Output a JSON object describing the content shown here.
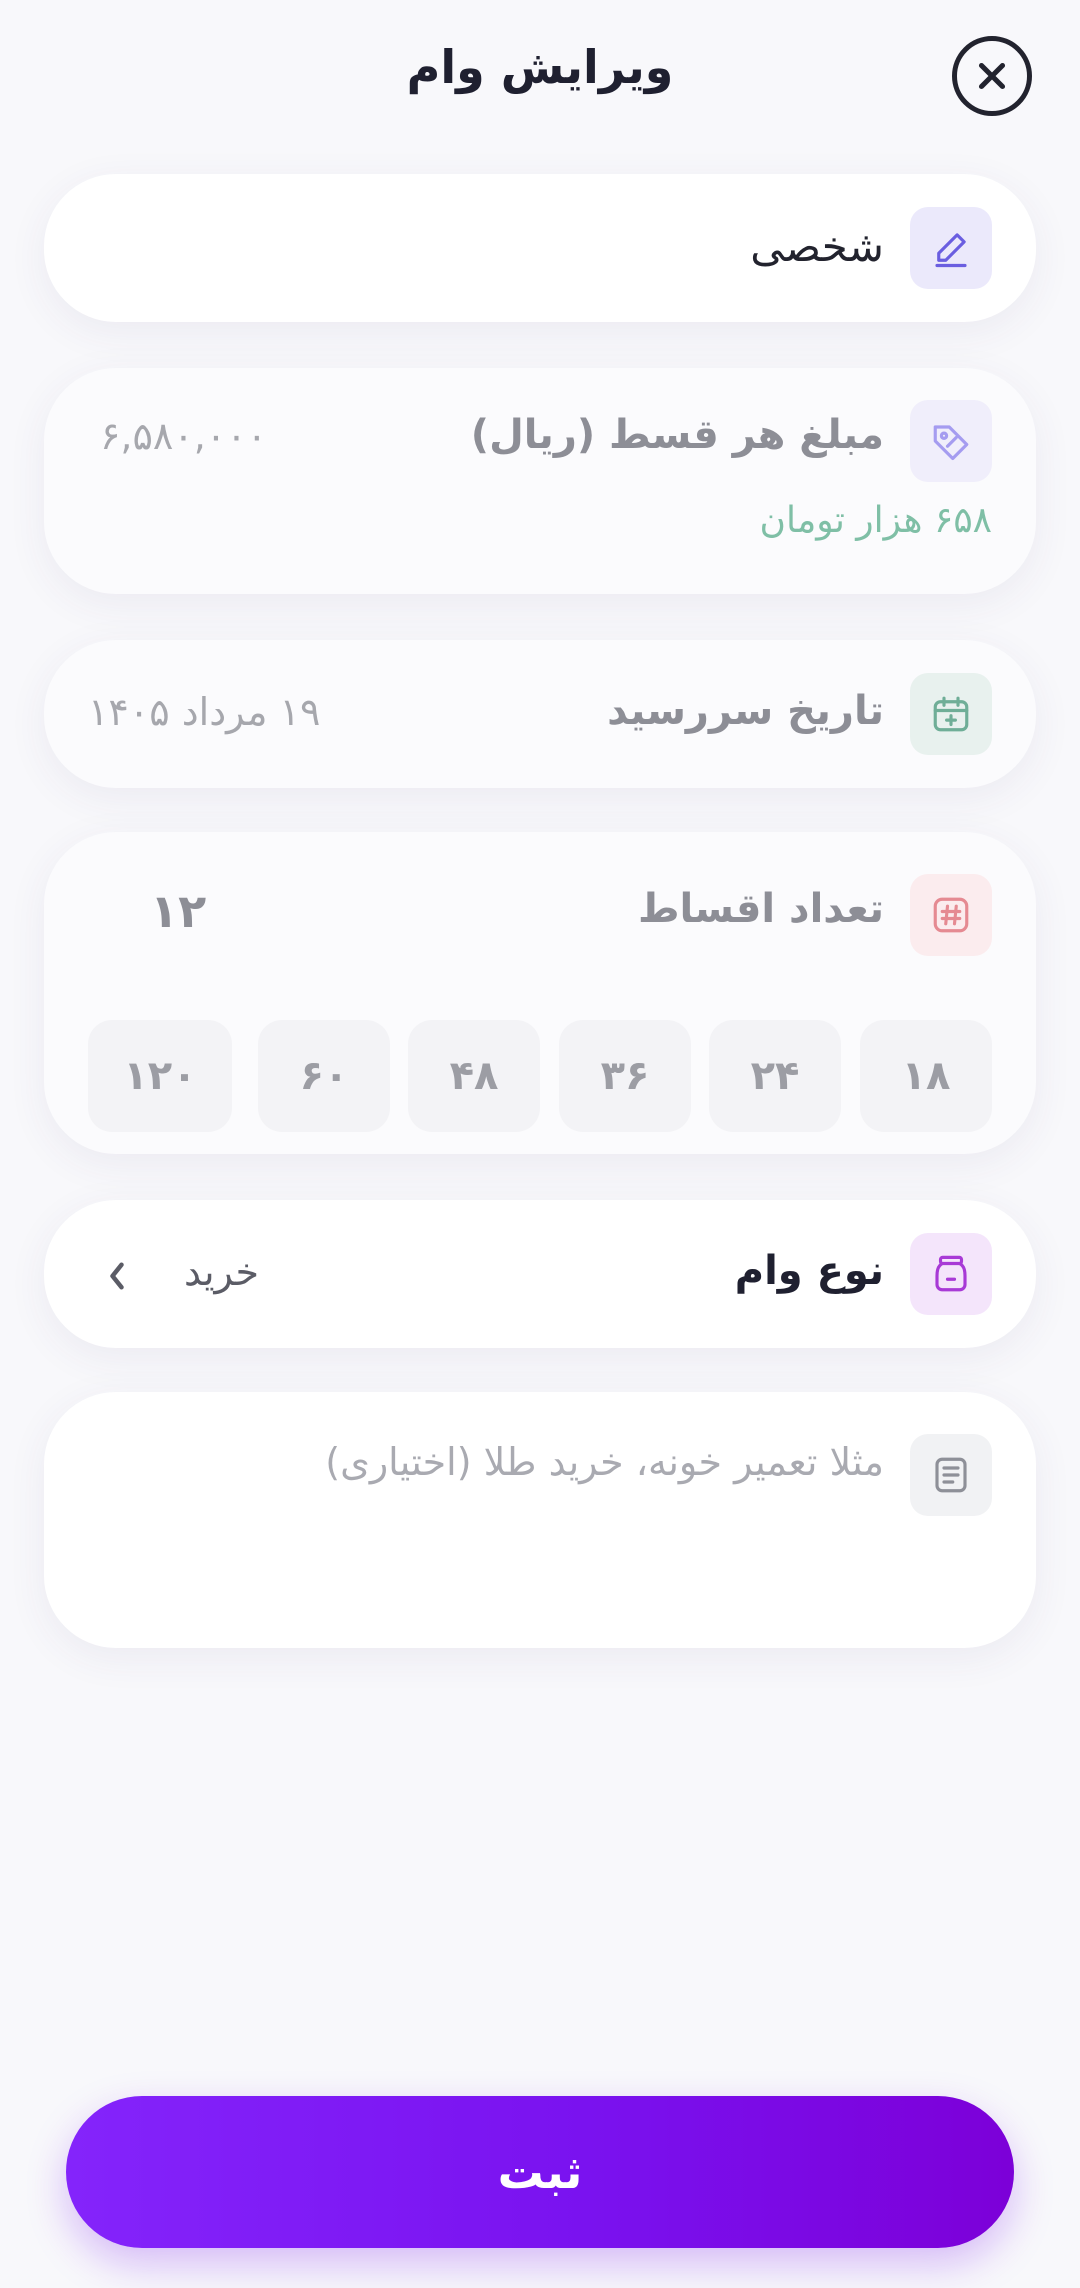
{
  "header": {
    "title": "ویرایش وام",
    "close_icon": "close-icon"
  },
  "name_field": {
    "value": "شخصی",
    "icon": "pencil-icon"
  },
  "amount_field": {
    "label": "مبلغ هر قسط (ریال)",
    "value": "۶,۵۸۰,۰۰۰",
    "hint": "۶۵۸ هزار تومان",
    "icon": "tag-icon"
  },
  "due_date_field": {
    "label": "تاریخ سررسید",
    "value": "۱۹ مرداد ۱۴۰۵",
    "icon": "calendar-plus-icon"
  },
  "installments_field": {
    "label": "تعداد اقساط",
    "value": "۱۲",
    "icon": "hash-icon",
    "options": [
      "۱۸",
      "۲۴",
      "۳۶",
      "۴۸",
      "۶۰",
      "۱۲۰"
    ]
  },
  "loan_type_field": {
    "label": "نوع وام",
    "value": "خرید",
    "icon": "jar-icon"
  },
  "note_field": {
    "placeholder": "مثلا تعمیر خونه، خرید طلا (اختیاری)",
    "icon": "note-icon"
  },
  "submit": {
    "label": "ثبت"
  },
  "colors": {
    "accent": "#7a12ef",
    "hint_green": "#7fbfa6"
  }
}
